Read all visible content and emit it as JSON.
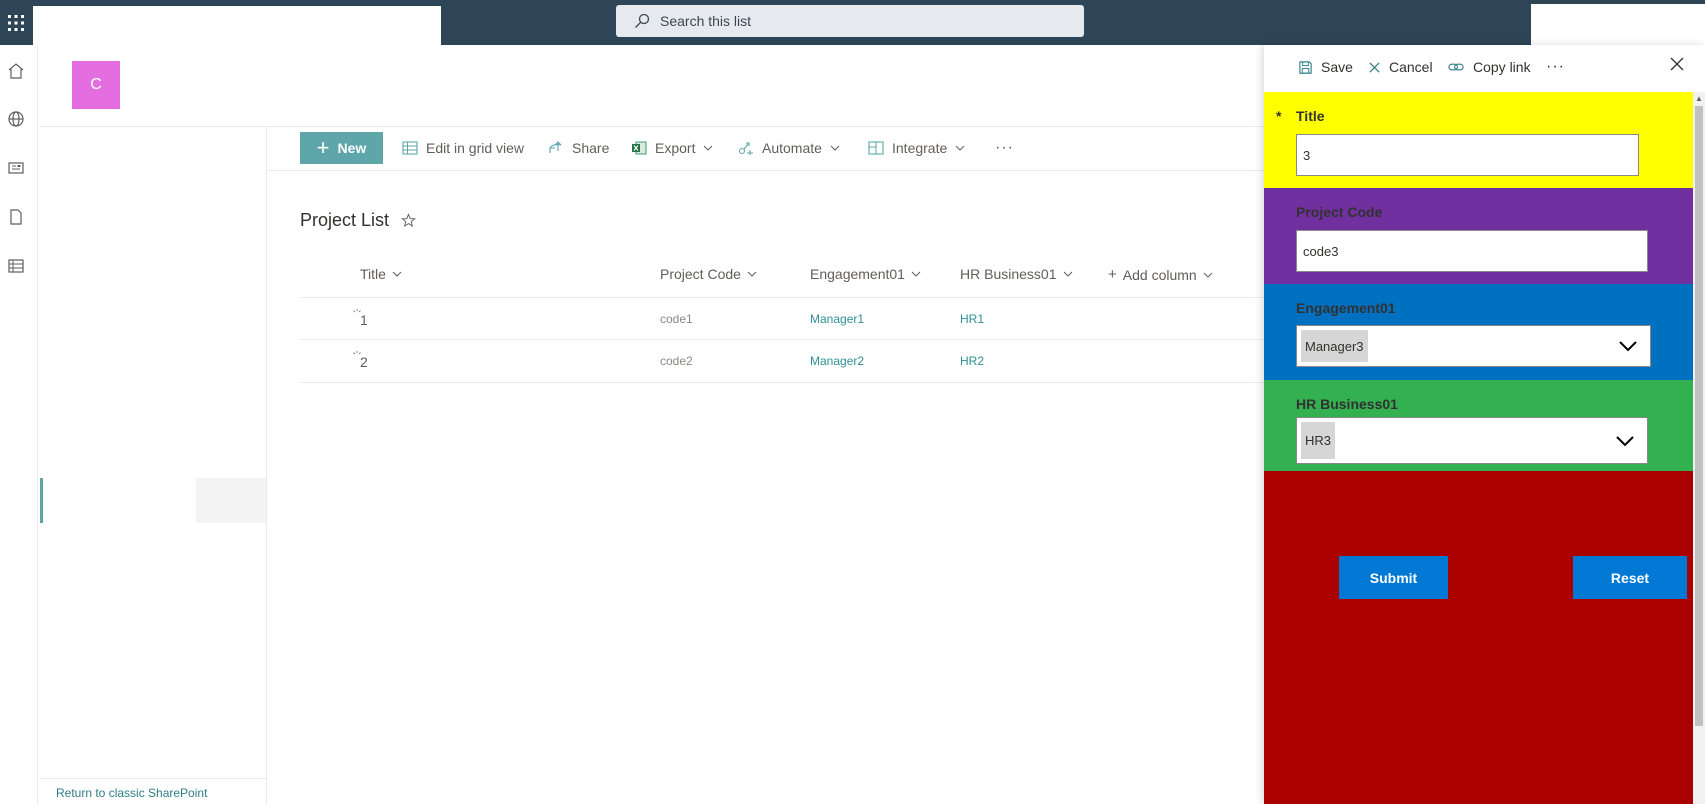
{
  "search": {
    "placeholder": "Search this list"
  },
  "site": {
    "logo_letter": "C"
  },
  "rail": {
    "icons": [
      "home-icon",
      "globe-icon",
      "news-icon",
      "document-icon",
      "list-icon"
    ]
  },
  "leftnav": {
    "classic_link": "Return to classic SharePoint"
  },
  "commandbar": {
    "new_label": "New",
    "edit_grid_label": "Edit in grid view",
    "share_label": "Share",
    "export_label": "Export",
    "automate_label": "Automate",
    "integrate_label": "Integrate",
    "more_label": "···"
  },
  "list": {
    "title": "Project List",
    "columns": {
      "title": "Title",
      "project_code": "Project Code",
      "engagement": "Engagement01",
      "hr_business": "HR Business01",
      "add_column": "Add column"
    },
    "rows": [
      {
        "title": "1",
        "project_code": "code1",
        "engagement": "Manager1",
        "hr_business": "HR1"
      },
      {
        "title": "2",
        "project_code": "code2",
        "engagement": "Manager2",
        "hr_business": "HR2"
      }
    ]
  },
  "panel": {
    "save_label": "Save",
    "cancel_label": "Cancel",
    "copy_link_label": "Copy link",
    "more_label": "···",
    "form": {
      "title_label": "Title",
      "required_mark": "*",
      "title_value": "3",
      "project_code_label": "Project Code",
      "project_code_value": "code3",
      "engagement_label": "Engagement01",
      "engagement_value": "Manager3",
      "hr_label": "HR Business01",
      "hr_value": "HR3",
      "submit_label": "Submit",
      "reset_label": "Reset"
    },
    "section_colors": {
      "title": "#ffff00",
      "project_code": "#7030a0",
      "engagement": "#0070c0",
      "hr": "#33b050",
      "buttons": "#aa0000"
    }
  },
  "colors": {
    "suite_bar": "#2e4557",
    "accent": "#5ea6aa",
    "logo": "#e46de0",
    "button_blue": "#0078d4"
  }
}
